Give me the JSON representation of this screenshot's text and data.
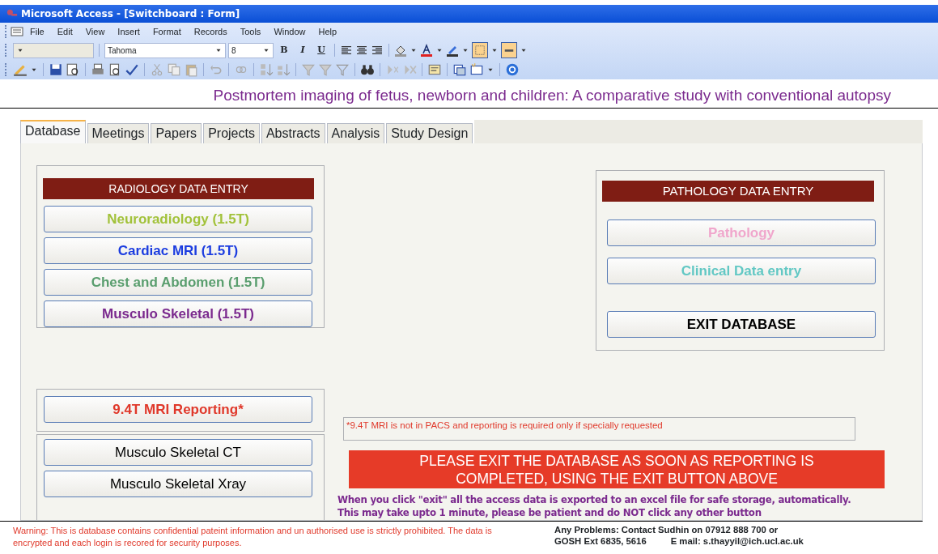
{
  "window": {
    "title": "Microsoft Access - [Switchboard : Form]"
  },
  "menu": [
    "File",
    "Edit",
    "View",
    "Insert",
    "Format",
    "Records",
    "Tools",
    "Window",
    "Help"
  ],
  "format_toolbar": {
    "object_combo": {
      "disabled": true
    },
    "font": "Tahoma",
    "size": "8",
    "style_buttons": [
      "B",
      "I",
      "U"
    ],
    "border_buttons": [
      {
        "on": true
      },
      {
        "on": true
      }
    ]
  },
  "heading": "Postmortem imaging of fetus, newborn and children: A comparative study with conventional autopsy",
  "tabs": [
    {
      "label": "Database",
      "selected": true
    },
    {
      "label": "Meetings",
      "selected": false
    },
    {
      "label": "Papers",
      "selected": false
    },
    {
      "label": "Projects",
      "selected": false
    },
    {
      "label": "Abstracts",
      "selected": false
    },
    {
      "label": "Analysis",
      "selected": false
    },
    {
      "label": "Study Design",
      "selected": false
    }
  ],
  "radiology": {
    "title": "RADIOLOGY DATA ENTRY",
    "buttons": [
      {
        "label": "Neuroradiology (1.5T)",
        "color": "#a2c23a"
      },
      {
        "label": "Cardiac MRI (1.5T)",
        "color": "#1c3de0"
      },
      {
        "label": "Chest and Abdomen (1.5T)",
        "color": "#5a9e6e"
      },
      {
        "label": "Musculo Skeletal (1.5T)",
        "color": "#7b2a8e"
      }
    ]
  },
  "reporting": {
    "label": "9.4T MRI Reporting*",
    "color": "#e0382a"
  },
  "other_buttons": [
    {
      "label": "Musculo Skeletal CT",
      "color": "#000000"
    },
    {
      "label": "Musculo Skeletal Xray",
      "color": "#000000"
    }
  ],
  "pathology": {
    "title": "PATHOLOGY DATA ENTRY",
    "buttons": [
      {
        "label": "Pathology",
        "color": "#f0a6cc"
      },
      {
        "label": "Clinical Data entry",
        "color": "#62c8c4"
      },
      {
        "label": "EXIT DATABASE",
        "color": "#000000"
      }
    ]
  },
  "note": "*9.4T MRI is not in PACS and reporting is required only if specially requested",
  "banner": "PLEASE EXIT THE DATABASE AS SOON AS REPORTING IS COMPLETED, USING THE EXIT BUTTON ABOVE",
  "export_info": "When you click \"exit\" all the access data is exported to an excel file for safe storage, automatically. This may take upto 1 minute, please be patient and do NOT click any other button",
  "warning": "Warning: This is database contains confidential pateint information and un authorised use is strictly prohibited. The data is encrypted and each login is recored for security purposes.",
  "contact": [
    "Any Problems: Contact Sudhin on 07912 888 700 or",
    "GOSH Ext 6835, 5616",
    "E mail: s.thayyil@ich.ucl.ac.uk"
  ]
}
